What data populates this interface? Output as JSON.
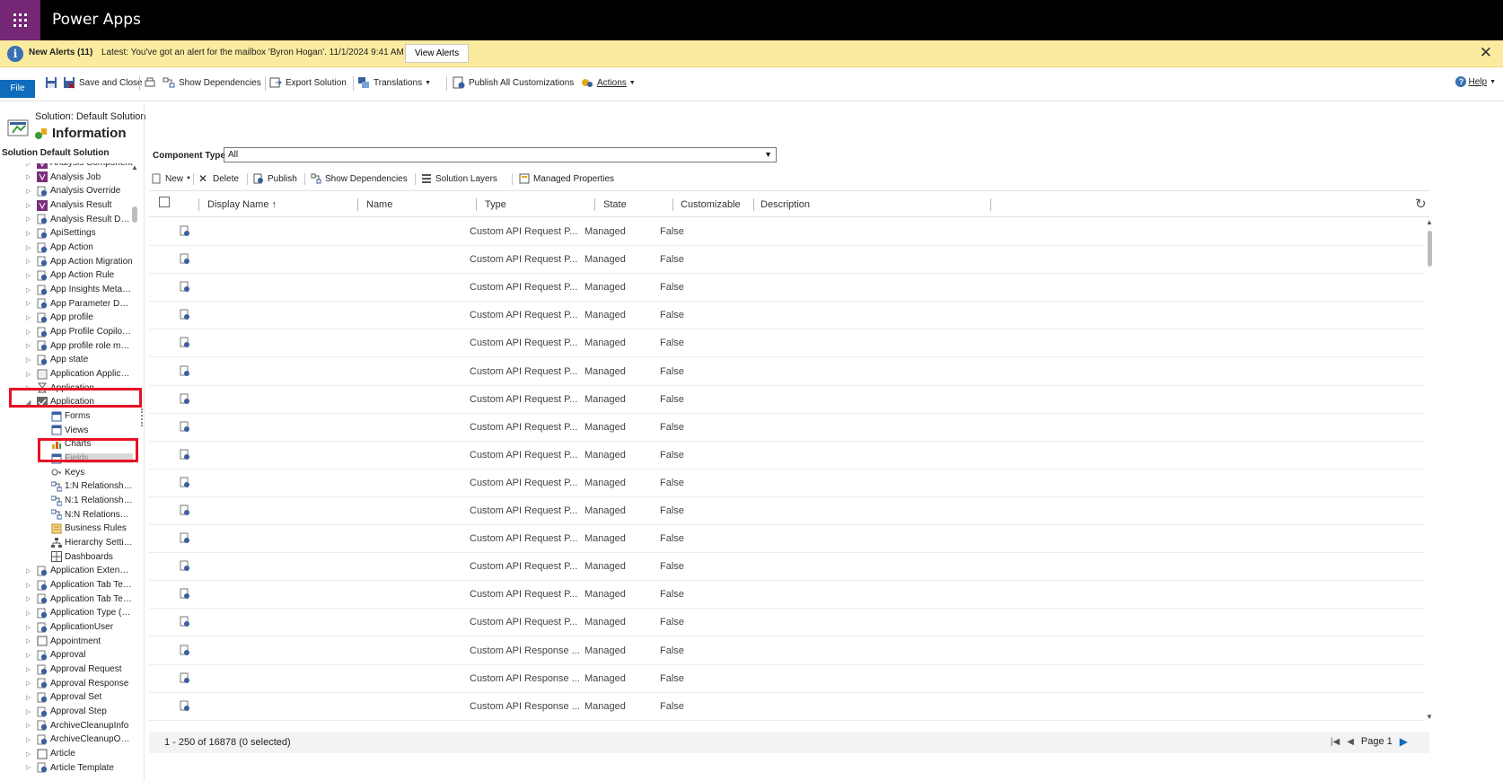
{
  "app": {
    "title": "Power Apps"
  },
  "alert": {
    "title": "New Alerts (11)",
    "text": "Latest: You've got an alert for the mailbox 'Byron Hogan'. 11/1/2024 9:41 AM",
    "button": "View Alerts"
  },
  "toolbar": {
    "file": "File",
    "save_and_close": "Save and Close",
    "show_dependencies": "Show Dependencies",
    "export_solution": "Export Solution",
    "translations": "Translations",
    "publish_all": "Publish All Customizations",
    "actions": "Actions",
    "help": "Help"
  },
  "solution": {
    "name": "Solution: Default Solution",
    "section": "Information",
    "tree_header": "Solution Default Solution"
  },
  "tree": [
    {
      "label": "Analysis Component",
      "level": 0,
      "icon": "purple"
    },
    {
      "label": "Analysis Job",
      "level": 0,
      "icon": "purple"
    },
    {
      "label": "Analysis Override",
      "level": 0,
      "icon": "entity"
    },
    {
      "label": "Analysis Result",
      "level": 0,
      "icon": "purple"
    },
    {
      "label": "Analysis Result Detail",
      "level": 0,
      "icon": "entity"
    },
    {
      "label": "ApiSettings",
      "level": 0,
      "icon": "entity"
    },
    {
      "label": "App Action",
      "level": 0,
      "icon": "entity"
    },
    {
      "label": "App Action Migration",
      "level": 0,
      "icon": "entity"
    },
    {
      "label": "App Action Rule",
      "level": 0,
      "icon": "entity"
    },
    {
      "label": "App Insights Metad...",
      "level": 0,
      "icon": "entity"
    },
    {
      "label": "App Parameter Defi...",
      "level": 0,
      "icon": "entity"
    },
    {
      "label": "App profile",
      "level": 0,
      "icon": "entity"
    },
    {
      "label": "App Profile Copilot ...",
      "level": 0,
      "icon": "entity"
    },
    {
      "label": "App profile role ma...",
      "level": 0,
      "icon": "entity"
    },
    {
      "label": "App state",
      "level": 0,
      "icon": "entity"
    },
    {
      "label": "Application Applicati...",
      "level": 0,
      "icon": "image"
    },
    {
      "label": "Application",
      "level": 0,
      "icon": "hourglass"
    },
    {
      "label": "Application",
      "level": 0,
      "icon": "check",
      "expanded": true
    },
    {
      "label": "Forms",
      "level": 1,
      "icon": "form"
    },
    {
      "label": "Views",
      "level": 1,
      "icon": "form"
    },
    {
      "label": "Charts",
      "level": 1,
      "icon": "chart"
    },
    {
      "label": "Fields",
      "level": 1,
      "icon": "form",
      "selected": true
    },
    {
      "label": "Keys",
      "level": 1,
      "icon": "key"
    },
    {
      "label": "1:N Relationships",
      "level": 1,
      "icon": "rel"
    },
    {
      "label": "N:1 Relationships",
      "level": 1,
      "icon": "rel"
    },
    {
      "label": "N:N Relationships",
      "level": 1,
      "icon": "rel"
    },
    {
      "label": "Business Rules",
      "level": 1,
      "icon": "rule"
    },
    {
      "label": "Hierarchy Settin...",
      "level": 1,
      "icon": "hier"
    },
    {
      "label": "Dashboards",
      "level": 1,
      "icon": "dash"
    },
    {
      "label": "Application Extension",
      "level": 0,
      "icon": "entity"
    },
    {
      "label": "Application Tab Tem...",
      "level": 0,
      "icon": "entity"
    },
    {
      "label": "Application Tab Tem...",
      "level": 0,
      "icon": "entity"
    },
    {
      "label": "Application Type (D...",
      "level": 0,
      "icon": "entity"
    },
    {
      "label": "ApplicationUser",
      "level": 0,
      "icon": "entity"
    },
    {
      "label": "Appointment",
      "level": 0,
      "icon": "blank"
    },
    {
      "label": "Approval",
      "level": 0,
      "icon": "entity"
    },
    {
      "label": "Approval Request",
      "level": 0,
      "icon": "entity"
    },
    {
      "label": "Approval Response",
      "level": 0,
      "icon": "entity"
    },
    {
      "label": "Approval Set",
      "level": 0,
      "icon": "entity"
    },
    {
      "label": "Approval Step",
      "level": 0,
      "icon": "entity"
    },
    {
      "label": "ArchiveCleanupInfo",
      "level": 0,
      "icon": "entity"
    },
    {
      "label": "ArchiveCleanupOpe...",
      "level": 0,
      "icon": "entity"
    },
    {
      "label": "Article",
      "level": 0,
      "icon": "blank"
    },
    {
      "label": "Article Template",
      "level": 0,
      "icon": "entity"
    }
  ],
  "main": {
    "component_type_label": "Component Type",
    "component_type_value": "All",
    "grid_toolbar": {
      "new": "New",
      "delete": "Delete",
      "publish": "Publish",
      "show_dependencies": "Show Dependencies",
      "solution_layers": "Solution Layers",
      "managed_properties": "Managed Properties"
    },
    "columns": [
      "Display Name ↑",
      "Name",
      "Type",
      "State",
      "Customizable",
      "Description"
    ],
    "rows": [
      {
        "type": "Custom API Request P...",
        "state": "Managed",
        "customizable": "False"
      },
      {
        "type": "Custom API Request P...",
        "state": "Managed",
        "customizable": "False"
      },
      {
        "type": "Custom API Request P...",
        "state": "Managed",
        "customizable": "False"
      },
      {
        "type": "Custom API Request P...",
        "state": "Managed",
        "customizable": "False"
      },
      {
        "type": "Custom API Request P...",
        "state": "Managed",
        "customizable": "False"
      },
      {
        "type": "Custom API Request P...",
        "state": "Managed",
        "customizable": "False"
      },
      {
        "type": "Custom API Request P...",
        "state": "Managed",
        "customizable": "False"
      },
      {
        "type": "Custom API Request P...",
        "state": "Managed",
        "customizable": "False"
      },
      {
        "type": "Custom API Request P...",
        "state": "Managed",
        "customizable": "False"
      },
      {
        "type": "Custom API Request P...",
        "state": "Managed",
        "customizable": "False"
      },
      {
        "type": "Custom API Request P...",
        "state": "Managed",
        "customizable": "False"
      },
      {
        "type": "Custom API Request P...",
        "state": "Managed",
        "customizable": "False"
      },
      {
        "type": "Custom API Request P...",
        "state": "Managed",
        "customizable": "False"
      },
      {
        "type": "Custom API Request P...",
        "state": "Managed",
        "customizable": "False"
      },
      {
        "type": "Custom API Request P...",
        "state": "Managed",
        "customizable": "False"
      },
      {
        "type": "Custom API Response ...",
        "state": "Managed",
        "customizable": "False"
      },
      {
        "type": "Custom API Response ...",
        "state": "Managed",
        "customizable": "False"
      },
      {
        "type": "Custom API Response ...",
        "state": "Managed",
        "customizable": "False"
      }
    ],
    "footer_count": "1 - 250 of 16878 (0 selected)",
    "page_label": "Page 1"
  },
  "colors": {
    "waffle": "#742774",
    "alert_bg": "#fbeb9f",
    "accent": "#0f6cbd",
    "highlight": "#e81123"
  }
}
